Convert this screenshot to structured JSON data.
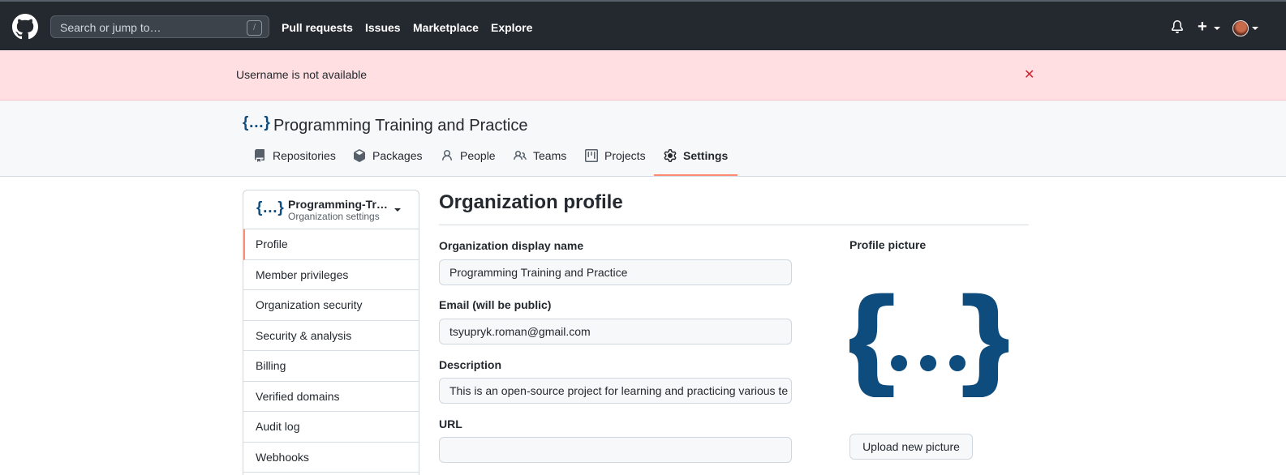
{
  "topbar": {
    "search_placeholder": "Search or jump to…",
    "search_shortcut": "/",
    "nav": [
      "Pull requests",
      "Issues",
      "Marketplace",
      "Explore"
    ],
    "plus": "+"
  },
  "flash": {
    "message": "Username is not available",
    "close": "✕"
  },
  "org": {
    "logo_text": "{…}",
    "name": "Programming Training and Practice",
    "tabs": [
      {
        "label": "Repositories",
        "icon": "repo-icon"
      },
      {
        "label": "Packages",
        "icon": "package-icon"
      },
      {
        "label": "People",
        "icon": "person-icon"
      },
      {
        "label": "Teams",
        "icon": "people-icon"
      },
      {
        "label": "Projects",
        "icon": "project-icon"
      },
      {
        "label": "Settings",
        "icon": "gear-icon",
        "active": true
      }
    ]
  },
  "sidebar": {
    "org_short": "Programming-Tr…",
    "subtitle": "Organization settings",
    "items": [
      {
        "label": "Profile",
        "active": true
      },
      {
        "label": "Member privileges"
      },
      {
        "label": "Organization security"
      },
      {
        "label": "Security & analysis"
      },
      {
        "label": "Billing"
      },
      {
        "label": "Verified domains"
      },
      {
        "label": "Audit log"
      },
      {
        "label": "Webhooks"
      }
    ]
  },
  "main": {
    "title": "Organization profile",
    "fields": [
      {
        "label": "Organization display name",
        "value": "Programming Training and Practice"
      },
      {
        "label": "Email (will be public)",
        "value": "tsyupryk.roman@gmail.com"
      },
      {
        "label": "Description",
        "value": "This is an open-source project for learning and practicing various te"
      },
      {
        "label": "URL",
        "value": ""
      }
    ],
    "profile_picture_label": "Profile picture",
    "upload_button": "Upload new picture"
  },
  "colors": {
    "header_bg": "#24292f",
    "flash_bg": "#ffdfe1",
    "flash_close": "#cf222e",
    "active_tab_accent": "#fd8c73",
    "logo_blue": "#0e4c7d"
  }
}
